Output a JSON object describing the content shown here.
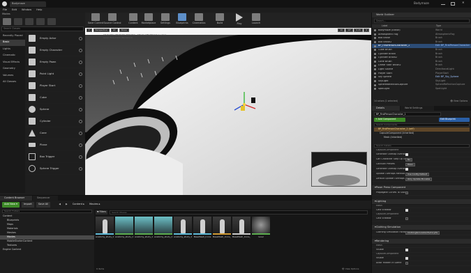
{
  "window": {
    "title": "Bodymaze",
    "tab_label": "Bodymaze"
  },
  "menu": [
    "File",
    "Edit",
    "Window",
    "Help"
  ],
  "modes": {
    "header": "Modes",
    "search_placeholder": "Search Classes",
    "recently_placed": "Recently Placed",
    "categories": [
      "Basic",
      "Lights",
      "Cinematic",
      "Visual Effects",
      "Geometry",
      "Volumes",
      "All Classes"
    ],
    "items": [
      "Empty Actor",
      "Empty Character",
      "Empty Pawn",
      "Point Light",
      "Player Start",
      "Cube",
      "Sphere",
      "Cylinder",
      "Cone",
      "Plane",
      "Box Trigger",
      "Sphere Trigger"
    ]
  },
  "toolbar": [
    "Save Current",
    "Source Control",
    "Content",
    "Marketplace",
    "Settings",
    "Blueprints",
    "Cinematics",
    "Build",
    "Play",
    "Launch"
  ],
  "viewport": {
    "perspective_label": "Perspective",
    "lit_label": "Lit",
    "show_label": "Show",
    "info_line1": "SELECTED VIEWPORT: PREVIEW - SEE TO SEE RESULT (1 actor)",
    "info_line2": "Level: Bodymaze (Persistent)",
    "grid_snap": "10",
    "rot_snap": "10°",
    "scale_snap": "0.25",
    "cam_speed": "4"
  },
  "outliner": {
    "header": "World Outliner",
    "search_placeholder": "Search...",
    "col_label": "Label",
    "col_type": "Type",
    "rows": [
      {
        "label": "Bodymaze (Editor)",
        "type": "World"
      },
      {
        "label": "Atmospheric Fog",
        "type": "AtmosphericFog"
      },
      {
        "label": "Box Brush",
        "type": "Brush"
      },
      {
        "label": "Box Brush2",
        "type": "Brush"
      },
      {
        "label": "BP_FirstPersonCharacter_1",
        "type": "Edit BP_FirstPersonCharacter"
      },
      {
        "label": "Cube Brush",
        "type": "Brush"
      },
      {
        "label": "Cylinder Brush",
        "type": "Brush"
      },
      {
        "label": "Cylinder Brush2",
        "type": "Brush"
      },
      {
        "label": "Cone Brush",
        "type": "Brush"
      },
      {
        "label": "Linear Stair Brush2",
        "type": "Brush"
      },
      {
        "label": "Light Source",
        "type": "DirectionalLight"
      },
      {
        "label": "Player Start",
        "type": "PlayerStart"
      },
      {
        "label": "Sky Sphere",
        "type": "Edit BP_Sky_Sphere"
      },
      {
        "label": "SkyLight",
        "type": "SkyLight"
      },
      {
        "label": "SphereReflectionCapture",
        "type": "SphereReflectionCapture"
      },
      {
        "label": "SpotLight",
        "type": "SpotLight"
      }
    ],
    "footer": "14 actors (1 selected)",
    "view_options": "View Options"
  },
  "details": {
    "tab_details": "Details",
    "tab_world_settings": "World Settings",
    "name_value": "BP_FirstPersonCharacter_1",
    "add_component": "+ Add Component",
    "edit_blueprint": "Edit Blueprint",
    "search_components_placeholder": "Search Components",
    "components": [
      "BP_FirstPersonCharacter_1 (self)",
      "CapsuleComponent (Inherited)",
      "Mesh (Inherited)"
    ],
    "search_details_placeholder": "Search Details",
    "rows": [
      {
        "k": "CapsuleComponent",
        "v": ""
      },
      {
        "k": "Generate Overlap Events",
        "v": "check"
      },
      {
        "k": "Can Character Step Up On",
        "v": "No"
      },
      {
        "k": "Collision Presets",
        "v": "Pawn"
      },
      {
        "k": "Generate Overlap Events",
        "v": "check"
      },
      {
        "k": "Update Overlaps Method",
        "v": "Use Config Default"
      },
      {
        "k": "Default Update Overlaps",
        "v": "Only Update Movable"
      }
    ],
    "sections": [
      "Poser Press Component",
      "Lighting",
      "Clothing Simulation",
      "Rendering"
    ],
    "sub_rows": [
      {
        "k": "Propagate Curves To Slaves",
        "v": "uncheck"
      },
      {
        "k": "Mesh",
        "v": ""
      },
      {
        "k": "Cast Shadow",
        "v": "check"
      },
      {
        "k": "CapsuleComponent",
        "v": ""
      },
      {
        "k": "Cast Shadow",
        "v": "uncheck"
      },
      {
        "k": "Clothing Simulation Factory",
        "v": "ClothingSimulationFactoryNv"
      },
      {
        "k": "Mesh",
        "v": ""
      },
      {
        "k": "Visible",
        "v": "check"
      },
      {
        "k": "CapsuleComponent",
        "v": ""
      },
      {
        "k": "Visible",
        "v": "check"
      },
      {
        "k": "Actor Hidden In Game",
        "v": "uncheck"
      }
    ]
  },
  "content_browser": {
    "tab_content": "Content Browser",
    "tab_sequencer": "Sequencer",
    "add_new": "Add New",
    "import": "Import",
    "save_all": "Save All",
    "path_content": "Content",
    "path_movies": "Movies",
    "search_folders_placeholder": "Search Folders",
    "filters_label": "Filters",
    "search_placeholder": "Search Movies",
    "tree": [
      "Content",
      "Blueprints",
      "Maps",
      "Materials",
      "Meshes",
      "Movies",
      "MobileStarterContent",
      "Textures",
      "Engine Content"
    ],
    "assets": [
      {
        "name": "anatomy_study_body_01_body",
        "kind": "mesh"
      },
      {
        "name": "anatomy_study_body_01_bottom",
        "kind": "mat"
      },
      {
        "name": "anatomy_study_body_01_pelvis",
        "kind": "mat"
      },
      {
        "name": "anatomy_study_body_01_top",
        "kind": "mat"
      },
      {
        "name": "anatomy_study_body_01_top",
        "kind": "mesh"
      },
      {
        "name": "BaseMesh_Icons",
        "kind": "mesh"
      },
      {
        "name": "BaseMesh_Icons_PhysicsAsset",
        "kind": "phys"
      },
      {
        "name": "BaseMesh_Icons_Skeleton",
        "kind": "skel"
      },
      {
        "name": "level",
        "kind": "mat"
      }
    ],
    "footer": "9 items",
    "view_options": "View Options"
  }
}
